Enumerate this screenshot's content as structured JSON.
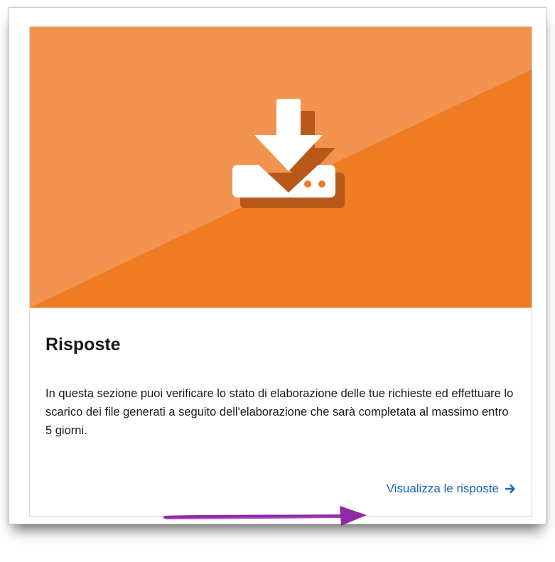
{
  "card": {
    "banner_icon": "download-drive-icon",
    "title": "Risposte",
    "description": "In questa sezione puoi verificare lo stato di elaborazione delle tue richieste ed effettuare lo scarico dei file generati a seguito dell'elaborazione che sarà completata al massimo entro 5 giorni.",
    "link_label": "Visualizza le risposte",
    "link_icon": "arrow-right-icon"
  },
  "annotation": {
    "icon": "purple-hand-drawn-arrow-icon"
  },
  "colors": {
    "banner_orange": "#ef7b22",
    "banner_light": "#f29450",
    "link_blue": "#1565c0",
    "annotation_purple": "#8e2aa3"
  }
}
